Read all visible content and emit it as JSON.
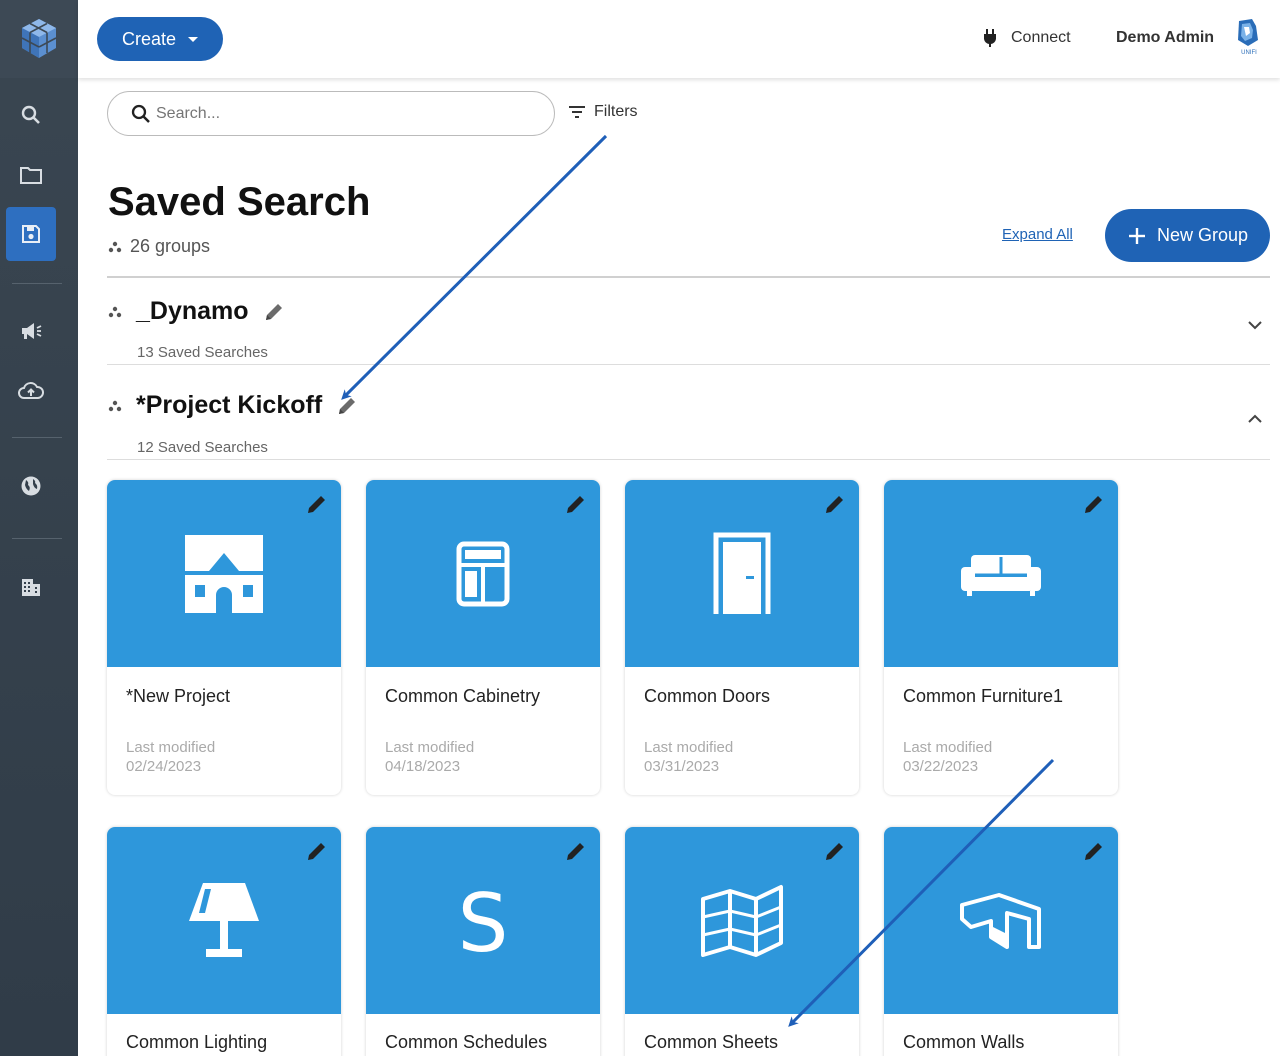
{
  "topbar": {
    "create_label": "Create",
    "connect_label": "Connect",
    "user_name": "Demo Admin",
    "user_logo_text": "UNIFI"
  },
  "search": {
    "placeholder": "Search...",
    "filters_label": "Filters"
  },
  "page": {
    "title": "Saved Search",
    "group_count": "26 groups",
    "expand_all": "Expand All",
    "new_group": "New Group"
  },
  "groups": [
    {
      "name": "_Dynamo",
      "subtitle": "13 Saved Searches",
      "expanded": false
    },
    {
      "name": "*Project Kickoff",
      "subtitle": "12 Saved Searches",
      "expanded": true
    }
  ],
  "cards": [
    {
      "name": "*New Project",
      "modified_label": "Last modified",
      "modified_date": "02/24/2023",
      "icon": "house-icon"
    },
    {
      "name": "Common Cabinetry",
      "modified_label": "Last modified",
      "modified_date": "04/18/2023",
      "icon": "cabinet-icon"
    },
    {
      "name": "Common Doors",
      "modified_label": "Last modified",
      "modified_date": "03/31/2023",
      "icon": "door-icon"
    },
    {
      "name": "Common Furniture1",
      "modified_label": "Last modified",
      "modified_date": "03/22/2023",
      "icon": "sofa-icon"
    },
    {
      "name": "Common Lighting",
      "icon": "lamp-icon"
    },
    {
      "name": "Common Schedules",
      "icon": "schedule-s-icon"
    },
    {
      "name": "Common Sheets",
      "icon": "map-sheets-icon"
    },
    {
      "name": "Common Walls",
      "icon": "walls-icon"
    }
  ],
  "colors": {
    "sidebar": "#34404c",
    "accent": "#1f63b5",
    "card_thumb": "#2e97db",
    "annotation_arrow": "#1f5fb8"
  }
}
